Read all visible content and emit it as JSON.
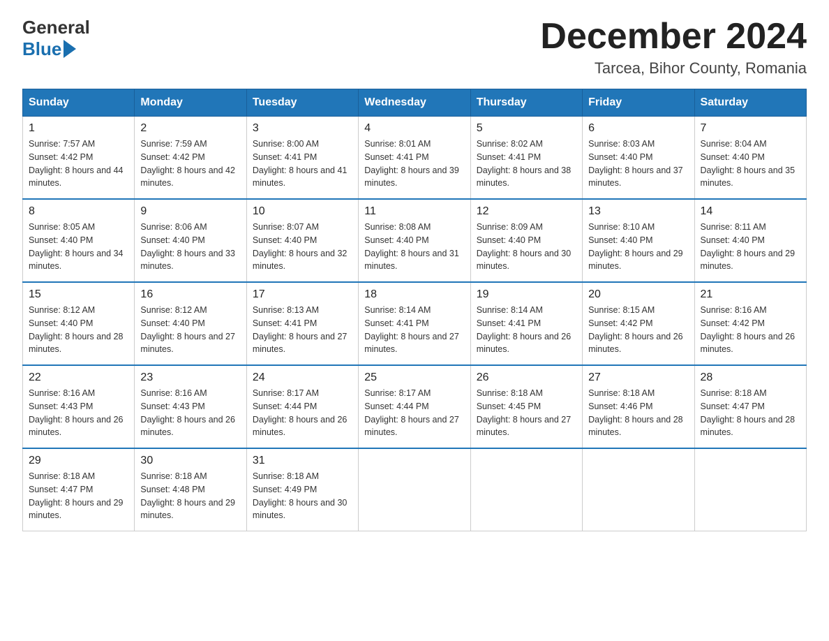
{
  "header": {
    "logo_general": "General",
    "logo_blue": "Blue",
    "month_title": "December 2024",
    "location": "Tarcea, Bihor County, Romania"
  },
  "days_of_week": [
    "Sunday",
    "Monday",
    "Tuesday",
    "Wednesday",
    "Thursday",
    "Friday",
    "Saturday"
  ],
  "weeks": [
    [
      {
        "day": "1",
        "sunrise": "7:57 AM",
        "sunset": "4:42 PM",
        "daylight": "8 hours and 44 minutes."
      },
      {
        "day": "2",
        "sunrise": "7:59 AM",
        "sunset": "4:42 PM",
        "daylight": "8 hours and 42 minutes."
      },
      {
        "day": "3",
        "sunrise": "8:00 AM",
        "sunset": "4:41 PM",
        "daylight": "8 hours and 41 minutes."
      },
      {
        "day": "4",
        "sunrise": "8:01 AM",
        "sunset": "4:41 PM",
        "daylight": "8 hours and 39 minutes."
      },
      {
        "day": "5",
        "sunrise": "8:02 AM",
        "sunset": "4:41 PM",
        "daylight": "8 hours and 38 minutes."
      },
      {
        "day": "6",
        "sunrise": "8:03 AM",
        "sunset": "4:40 PM",
        "daylight": "8 hours and 37 minutes."
      },
      {
        "day": "7",
        "sunrise": "8:04 AM",
        "sunset": "4:40 PM",
        "daylight": "8 hours and 35 minutes."
      }
    ],
    [
      {
        "day": "8",
        "sunrise": "8:05 AM",
        "sunset": "4:40 PM",
        "daylight": "8 hours and 34 minutes."
      },
      {
        "day": "9",
        "sunrise": "8:06 AM",
        "sunset": "4:40 PM",
        "daylight": "8 hours and 33 minutes."
      },
      {
        "day": "10",
        "sunrise": "8:07 AM",
        "sunset": "4:40 PM",
        "daylight": "8 hours and 32 minutes."
      },
      {
        "day": "11",
        "sunrise": "8:08 AM",
        "sunset": "4:40 PM",
        "daylight": "8 hours and 31 minutes."
      },
      {
        "day": "12",
        "sunrise": "8:09 AM",
        "sunset": "4:40 PM",
        "daylight": "8 hours and 30 minutes."
      },
      {
        "day": "13",
        "sunrise": "8:10 AM",
        "sunset": "4:40 PM",
        "daylight": "8 hours and 29 minutes."
      },
      {
        "day": "14",
        "sunrise": "8:11 AM",
        "sunset": "4:40 PM",
        "daylight": "8 hours and 29 minutes."
      }
    ],
    [
      {
        "day": "15",
        "sunrise": "8:12 AM",
        "sunset": "4:40 PM",
        "daylight": "8 hours and 28 minutes."
      },
      {
        "day": "16",
        "sunrise": "8:12 AM",
        "sunset": "4:40 PM",
        "daylight": "8 hours and 27 minutes."
      },
      {
        "day": "17",
        "sunrise": "8:13 AM",
        "sunset": "4:41 PM",
        "daylight": "8 hours and 27 minutes."
      },
      {
        "day": "18",
        "sunrise": "8:14 AM",
        "sunset": "4:41 PM",
        "daylight": "8 hours and 27 minutes."
      },
      {
        "day": "19",
        "sunrise": "8:14 AM",
        "sunset": "4:41 PM",
        "daylight": "8 hours and 26 minutes."
      },
      {
        "day": "20",
        "sunrise": "8:15 AM",
        "sunset": "4:42 PM",
        "daylight": "8 hours and 26 minutes."
      },
      {
        "day": "21",
        "sunrise": "8:16 AM",
        "sunset": "4:42 PM",
        "daylight": "8 hours and 26 minutes."
      }
    ],
    [
      {
        "day": "22",
        "sunrise": "8:16 AM",
        "sunset": "4:43 PM",
        "daylight": "8 hours and 26 minutes."
      },
      {
        "day": "23",
        "sunrise": "8:16 AM",
        "sunset": "4:43 PM",
        "daylight": "8 hours and 26 minutes."
      },
      {
        "day": "24",
        "sunrise": "8:17 AM",
        "sunset": "4:44 PM",
        "daylight": "8 hours and 26 minutes."
      },
      {
        "day": "25",
        "sunrise": "8:17 AM",
        "sunset": "4:44 PM",
        "daylight": "8 hours and 27 minutes."
      },
      {
        "day": "26",
        "sunrise": "8:18 AM",
        "sunset": "4:45 PM",
        "daylight": "8 hours and 27 minutes."
      },
      {
        "day": "27",
        "sunrise": "8:18 AM",
        "sunset": "4:46 PM",
        "daylight": "8 hours and 28 minutes."
      },
      {
        "day": "28",
        "sunrise": "8:18 AM",
        "sunset": "4:47 PM",
        "daylight": "8 hours and 28 minutes."
      }
    ],
    [
      {
        "day": "29",
        "sunrise": "8:18 AM",
        "sunset": "4:47 PM",
        "daylight": "8 hours and 29 minutes."
      },
      {
        "day": "30",
        "sunrise": "8:18 AM",
        "sunset": "4:48 PM",
        "daylight": "8 hours and 29 minutes."
      },
      {
        "day": "31",
        "sunrise": "8:18 AM",
        "sunset": "4:49 PM",
        "daylight": "8 hours and 30 minutes."
      },
      null,
      null,
      null,
      null
    ]
  ],
  "labels": {
    "sunrise": "Sunrise: ",
    "sunset": "Sunset: ",
    "daylight": "Daylight: "
  }
}
